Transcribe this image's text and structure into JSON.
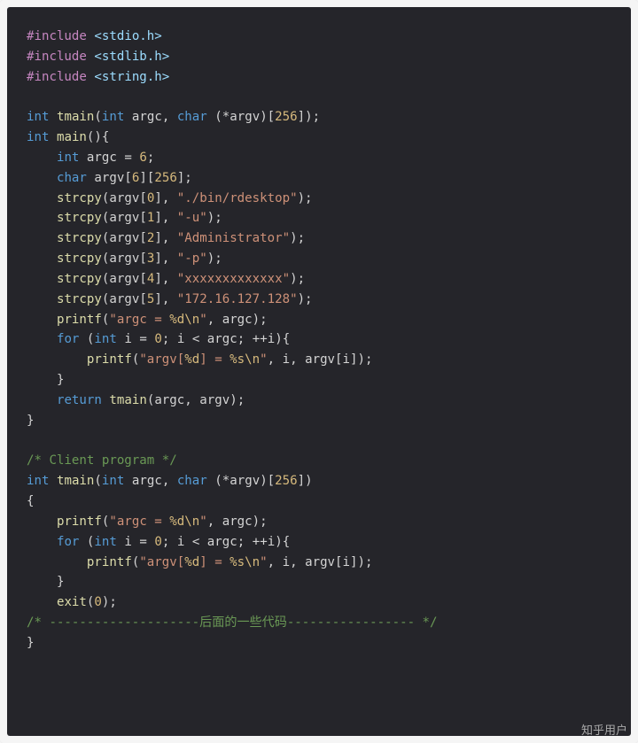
{
  "code": {
    "include1_kw": "#include",
    "include1_path": "<stdio.h>",
    "include2_kw": "#include",
    "include2_path": "<stdlib.h>",
    "include3_kw": "#include",
    "include3_path": "<string.h>",
    "sig1": {
      "int": "int",
      "tmain": "tmain",
      "open": "(",
      "int2": "int",
      "argc": "argc",
      "c1": ", ",
      "char": "char",
      "sp": " (*",
      "argv": "argv",
      "arr": ")[",
      "n256": "256",
      "close": "]);"
    },
    "mainsig": {
      "int": "int",
      "main": "main",
      "rest": "(){"
    },
    "l_argc": {
      "int": "int",
      "argc": "argc",
      "eq": " = ",
      "n6": "6",
      "sc": ";"
    },
    "l_argvd": {
      "char": "char",
      "argv": "argv",
      "o1": "[",
      "n6": "6",
      "c1": "][",
      "n256": "256",
      "c2": "];"
    },
    "strcpy0": {
      "fn": "strcpy",
      "o": "(",
      "argv": "argv",
      "lb": "[",
      "idx": "0",
      "rb": "], ",
      "s": "\"./bin/rdesktop\"",
      "close": ");"
    },
    "strcpy1": {
      "fn": "strcpy",
      "o": "(",
      "argv": "argv",
      "lb": "[",
      "idx": "1",
      "rb": "], ",
      "s": "\"-u\"",
      "close": ");"
    },
    "strcpy2": {
      "fn": "strcpy",
      "o": "(",
      "argv": "argv",
      "lb": "[",
      "idx": "2",
      "rb": "], ",
      "s": "\"Administrator\"",
      "close": ");"
    },
    "strcpy3": {
      "fn": "strcpy",
      "o": "(",
      "argv": "argv",
      "lb": "[",
      "idx": "3",
      "rb": "], ",
      "s": "\"-p\"",
      "close": ");"
    },
    "strcpy4": {
      "fn": "strcpy",
      "o": "(",
      "argv": "argv",
      "lb": "[",
      "idx": "4",
      "rb": "], ",
      "s": "\"xxxxxxxxxxxxx\"",
      "close": ");"
    },
    "strcpy5": {
      "fn": "strcpy",
      "o": "(",
      "argv": "argv",
      "lb": "[",
      "idx": "5",
      "rb": "], ",
      "s": "\"172.16.127.128\"",
      "close": ");"
    },
    "printf1": {
      "fn": "printf",
      "o": "(",
      "s1": "\"argc = ",
      "esc": "%d\\n",
      "s2": "\"",
      "c": ", ",
      "a": "argc",
      "close": ");"
    },
    "for1": {
      "for": "for",
      "o": " (",
      "int": "int",
      "i": "i",
      "eq": " = ",
      "z": "0",
      "sc": "; ",
      "i2": "i",
      "lt": " < ",
      "argc": "argc",
      "sc2": "; ++",
      "i3": "i",
      "close": "){"
    },
    "printf2": {
      "fn": "printf",
      "o": "(",
      "s1": "\"argv[",
      "esc1": "%d",
      "s2": "] = ",
      "esc2": "%s\\n",
      "s3": "\"",
      "c": ", ",
      "i": "i",
      "c2": ", ",
      "argv": "argv",
      "lb": "[",
      "i2": "i",
      "rb": "]);"
    },
    "rbrace": "}",
    "ret": {
      "return": "return",
      "tmain": "tmain",
      "o": "(",
      "argc": "argc",
      "c": ", ",
      "argv": "argv",
      "close": ");"
    },
    "cmt1": "/* Client program */",
    "sig2": {
      "int": "int",
      "tmain": "tmain",
      "open": "(",
      "int2": "int",
      "argc": "argc",
      "c1": ", ",
      "char": "char",
      "sp": " (*",
      "argv": "argv",
      "arr": ")[",
      "n256": "256",
      "close": "])"
    },
    "lbrace": "{",
    "exit": {
      "fn": "exit",
      "o": "(",
      "z": "0",
      "close": ");"
    },
    "cmt2": "/* --------------------后面的一些代码----------------- */"
  },
  "watermark": "知乎用户"
}
